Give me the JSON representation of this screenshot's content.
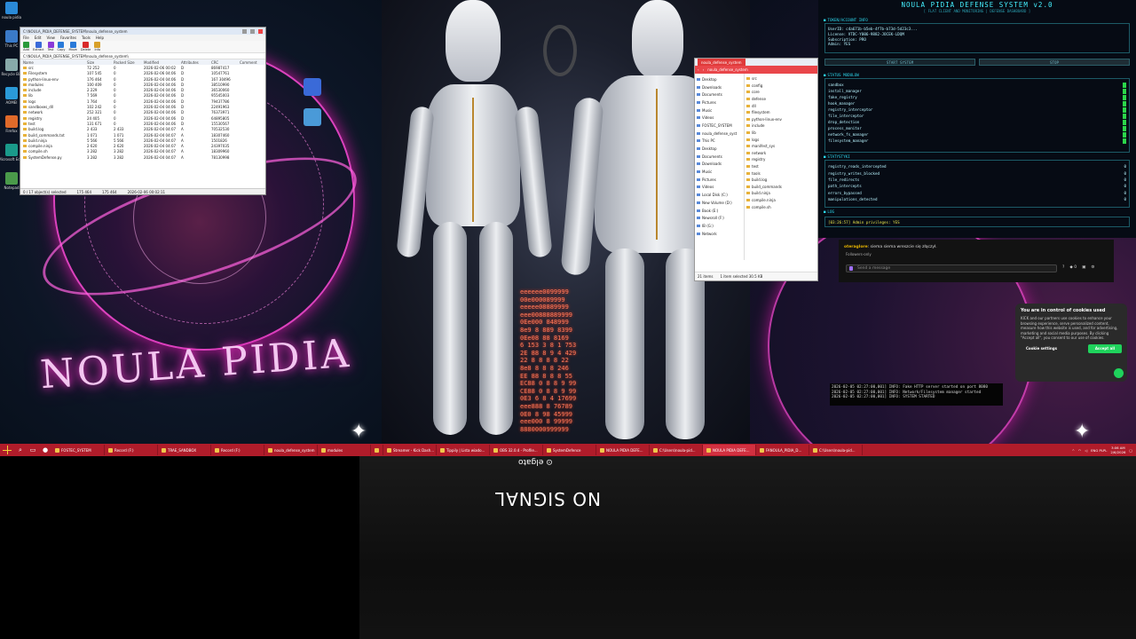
{
  "desktop": {
    "watermark": "NOULA PIDIA",
    "icons": [
      {
        "label": "noula pidia",
        "color": "#2a8ad8"
      },
      {
        "label": "This PC",
        "color": "#3a7ac8"
      },
      {
        "label": "Recycle Bin",
        "color": "#8aa"
      },
      {
        "label": "AOMEI",
        "color": "#2a9ad8"
      },
      {
        "label": "Firefox",
        "color": "#e06a2a"
      },
      {
        "label": "Microsoft Edge",
        "color": "#1a9a8a"
      },
      {
        "label": "Notepad",
        "color": "#4a9a4a"
      }
    ]
  },
  "explorer": {
    "title": "C:\\NOULA_PIDIA_DEFENSE_SYSTEM\\noula_defense_system",
    "menu": [
      "File",
      "Edit",
      "View",
      "Favorites",
      "Tools",
      "Help"
    ],
    "toolbar": [
      "Add",
      "Extract",
      "Test",
      "Copy",
      "Move",
      "Delete",
      "Info"
    ],
    "address": "C:\\NOULA_PIDIA_DEFENSE_SYSTEM\\noula_defense_system\\",
    "columns": [
      "Name",
      "Size",
      "Packed Size",
      "Modified",
      "Attributes",
      "CRC",
      "Comment"
    ],
    "rows": [
      {
        "name": "src",
        "size": "72 252",
        "packed": "0",
        "modified": "2026-02-06 00:02",
        "attr": "D",
        "crc": "86987417"
      },
      {
        "name": "Filesystem",
        "size": "107 545",
        "packed": "0",
        "modified": "2026-02-06 04:06",
        "attr": "D",
        "crc": "10547761"
      },
      {
        "name": "python-linux-env",
        "size": "176 464",
        "packed": "0",
        "modified": "2026-02-04 04:06",
        "attr": "D",
        "crc": "167 30496"
      },
      {
        "name": "modules",
        "size": "100 409",
        "packed": "0",
        "modified": "2026-02-04 04:06",
        "attr": "D",
        "crc": "38510990"
      },
      {
        "name": "include",
        "size": "2 229",
        "packed": "0",
        "modified": "2026-02-04 04:06",
        "attr": "D",
        "crc": "36530060"
      },
      {
        "name": "lib",
        "size": "7 569",
        "packed": "0",
        "modified": "2026-02-04 04:06",
        "attr": "D",
        "crc": "95545003"
      },
      {
        "name": "logs",
        "size": "1 764",
        "packed": "0",
        "modified": "2026-02-04 04:06",
        "attr": "D",
        "crc": "79437786"
      },
      {
        "name": "sandboxes_dll",
        "size": "102 242",
        "packed": "0",
        "modified": "2026-02-04 04:06",
        "attr": "D",
        "crc": "22491963"
      },
      {
        "name": "network",
        "size": "252 321",
        "packed": "0",
        "modified": "2026-02-04 04:06",
        "attr": "D",
        "crc": "76373971"
      },
      {
        "name": "registry",
        "size": "24 405",
        "packed": "0",
        "modified": "2026-02-04 04:06",
        "attr": "D",
        "crc": "64895805"
      },
      {
        "name": "test",
        "size": "131 671",
        "packed": "0",
        "modified": "2026-02-04 04:06",
        "attr": "D",
        "crc": "15530567"
      },
      {
        "name": "build.log",
        "size": "2 433",
        "packed": "2 433",
        "modified": "2026-02-04 04:07",
        "attr": "A",
        "crc": "70532530"
      },
      {
        "name": "build_commands.txt",
        "size": "1 071",
        "packed": "1 071",
        "modified": "2026-02-04 04:07",
        "attr": "A",
        "crc": "18307460"
      },
      {
        "name": "build.ninja",
        "size": "5 566",
        "packed": "5 566",
        "modified": "2026-02-04 04:07",
        "attr": "A",
        "crc": "1501826"
      },
      {
        "name": "compile.ninja",
        "size": "2 620",
        "packed": "2 620",
        "modified": "2026-02-04 04:07",
        "attr": "A",
        "crc": "24397035"
      },
      {
        "name": "compile.sh",
        "size": "3 282",
        "packed": "3 282",
        "modified": "2026-02-04 04:07",
        "attr": "A",
        "crc": "18309960"
      },
      {
        "name": "SystemDefense.py",
        "size": "3 282",
        "packed": "3 282",
        "modified": "2026-02-04 04:07",
        "attr": "A",
        "crc": "78130998"
      }
    ],
    "status": [
      "0 / 17 object(s) selected",
      "175 464",
      "175 464",
      "2026-02-06 00:02:11"
    ]
  },
  "matrix_text": "eeeeee0099999\n00e000089999\neeeee08889999\neee00888889999\n0Ee000 848999\n8e9 8 889 8399\n0Ee08 88 8169\n6 153 3 8 1 753\n2E 88 8 9 4 429\n22 8 8 8 8 22\n8e8 8 8 8 246\nEE 88 8 8 8 55\nEC88 0 8 8 9 99\nCE88 0 8 8 9 99\n0E3 6 8 4 17699\neee888 8 76789\n0E0 8 98 45999\neee000 8 99999\n8880000999999",
  "dialog": {
    "tab": "noula_defense_system",
    "nav_path": "noula_defense_system",
    "left": [
      "Desktop",
      "Downloads",
      "Documents",
      "Pictures",
      "Music",
      "Videos",
      "FOSTEC_SYSTEM",
      "noula_defense_syst",
      "This PC",
      "Desktop",
      "Documents",
      "Downloads",
      "Music",
      "Pictures",
      "Videos",
      "Local Disk (C:)",
      "New Volume (D:)",
      "Book (E:)",
      "Newsroll (F:)",
      "IB (G:)",
      "Network"
    ],
    "right": [
      "src",
      "config",
      "core",
      "defense",
      "dll",
      "filesystem",
      "python-linux-env",
      "include",
      "lib",
      "logs",
      "manifest_sys",
      "network",
      "registry",
      "test",
      "tools",
      "build.log",
      "build_commands",
      "build.ninja",
      "compile.ninja",
      "compile.sh"
    ],
    "footer": [
      "21 items",
      "1 item selected  30.5 KB"
    ]
  },
  "panel": {
    "title": "NOULA PIDIA DEFENSE SYSTEM v2.0",
    "subtitle": "[ FLAT CLIENT AND MONITORING | DEFENSE DASHBOARD ]",
    "token_head": "TOKEN/ACCOUNT INFO",
    "token_lines": [
      "UserID: c4a671b-b5eb-4f7b-b73d-5d23c3...",
      "License: VTDC-Y006-9882-JOCEK-LDQM",
      "Subscription: PRO",
      "Admin: YES"
    ],
    "btn_start": "START SYSTEM",
    "btn_stop": "STOP",
    "modules_head": "STATUS MODULOW",
    "modules": [
      "sandbox",
      "install_manager",
      "fake_registry",
      "hook_manager",
      "registry_interceptor",
      "file_interceptor",
      "drop_detection",
      "process_monitor",
      "network_fs_manager",
      "filesystem_manager"
    ],
    "stats_head": "STATYSTYKI",
    "stats": [
      [
        "registry_reads_intercepted",
        "0"
      ],
      [
        "registry_writes_blocked",
        "0"
      ],
      [
        "file_redirects",
        "0"
      ],
      [
        "path_intercepts",
        "0"
      ],
      [
        "errors_bypassed",
        "0"
      ],
      [
        "manipulations_detected",
        "0"
      ]
    ],
    "log_head": "LOG",
    "log_line": "[03:26:57] Admin privileges: YES"
  },
  "chat": {
    "user": "oteraglore",
    "message": "siema siema wreszcie się złączył.",
    "followers": "Followers-only",
    "placeholder": "Send a message",
    "icon_labels": [
      "?",
      "◆ 0",
      "▣",
      "⚙"
    ]
  },
  "terminal": [
    "2026-02-05 02:27:00,001] INFO: Fake HTTP server started on port 8080",
    "2026-02-05 02:27:00,001] INFO: Network/Filesystem manager started",
    "2026-02-05 02:27:00,001] INFO: SYSTEM STARTED"
  ],
  "cookie": {
    "title": "You are in control of cookies used",
    "body": "KICK and our partners use cookies to enhance your browsing experience, serve personalized content, measure how this website is used, and for advertising, marketing and social media purposes. By clicking \"Accept all\", you consent to our use of cookies.",
    "settings": "Cookie settings",
    "accept": "Accept all"
  },
  "taskbar": {
    "items": [
      {
        "label": "FOSTEC_SYSTEM",
        "active": false
      },
      {
        "label": "Record (F:)",
        "active": false
      },
      {
        "label": "TRAE_SANDBOX",
        "active": false
      },
      {
        "label": "Record (F:)",
        "active": false
      },
      {
        "label": "noula_defense_system",
        "active": false
      },
      {
        "label": "modules",
        "active": false
      },
      {
        "label": "",
        "active": false
      },
      {
        "label": "Streamer - Kick Dash...",
        "active": false
      },
      {
        "label": "Tippily | Lista wiado...",
        "active": false
      },
      {
        "label": "OBS 32.0.4 - Profile...",
        "active": false
      },
      {
        "label": "SystemDefence",
        "active": false
      },
      {
        "label": "NOULA PIDIA DEFE...",
        "active": false
      },
      {
        "label": "C:\\Users\\noula-pid...",
        "active": false
      },
      {
        "label": "NOULA PIDIA DEFE...",
        "active": true
      },
      {
        "label": "FANOULA_PIDIA_D...",
        "active": false
      },
      {
        "label": "C:\\Users\\noula-pid...",
        "active": false
      }
    ],
    "tray_lang": "ENG PLPL",
    "tray_time": "3:06 AM",
    "tray_date": "2/6/2026"
  },
  "capture": {
    "brand": "elgato",
    "no_signal": "NO SIGNAL"
  }
}
